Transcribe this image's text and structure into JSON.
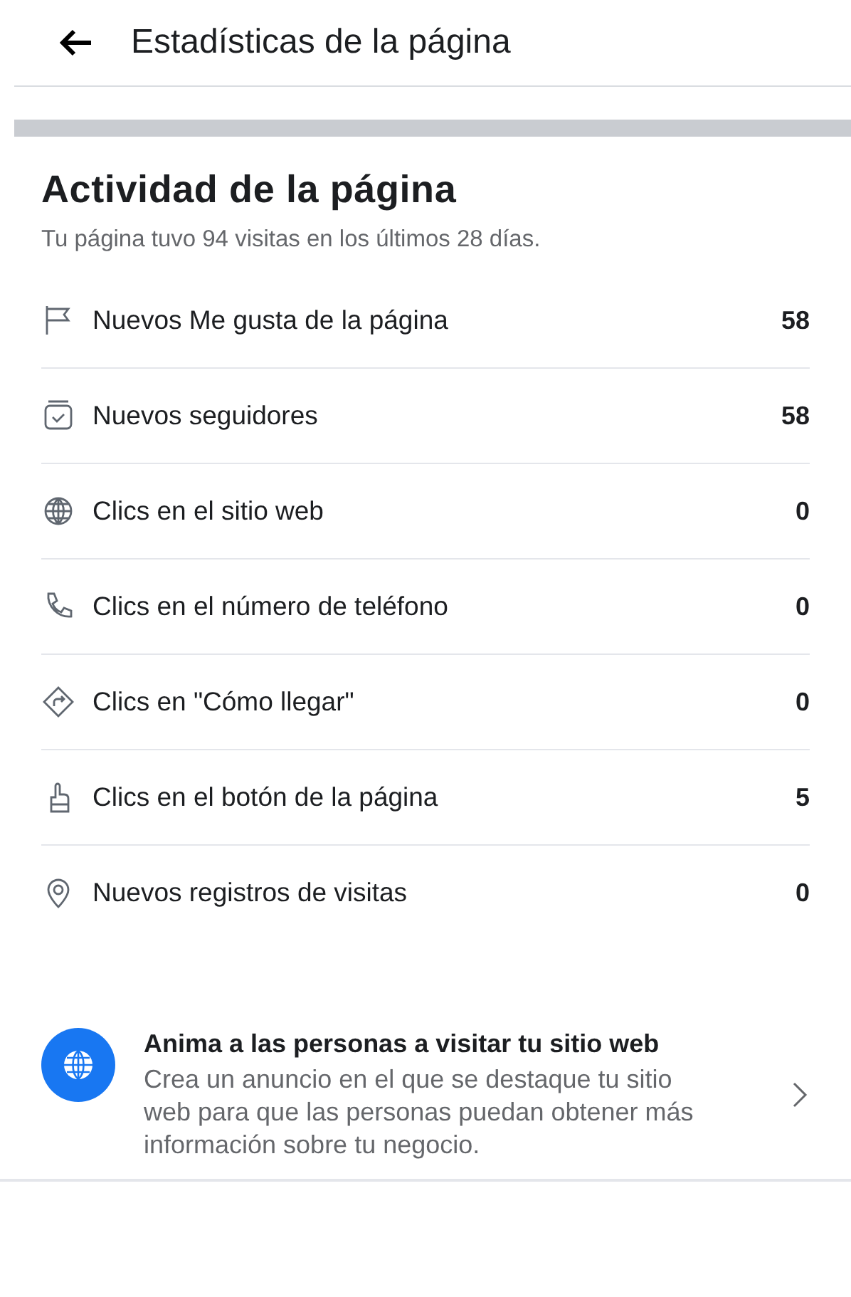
{
  "header": {
    "title": "Estadísticas de la página"
  },
  "section": {
    "title": "Actividad de la página",
    "subtitle": "Tu página tuvo 94 visitas en los últimos 28 días."
  },
  "rows": [
    {
      "kind": "flag",
      "label": "Nuevos Me gusta de la página",
      "value": "58"
    },
    {
      "kind": "calendar",
      "label": "Nuevos seguidores",
      "value": "58"
    },
    {
      "kind": "globe",
      "label": "Clics en el sitio web",
      "value": "0"
    },
    {
      "kind": "phone",
      "label": "Clics en el número de teléfono",
      "value": "0"
    },
    {
      "kind": "directions",
      "label": "Clics en \"Cómo llegar\"",
      "value": "0"
    },
    {
      "kind": "hand",
      "label": "Clics en el botón de la página",
      "value": "5"
    },
    {
      "kind": "pin",
      "label": "Nuevos registros de visitas",
      "value": "0"
    }
  ],
  "promo": {
    "title": "Anima a las personas a visitar tu sitio web",
    "description": "Crea un anuncio en el que se destaque tu sitio web para que las personas puedan obtener más información sobre tu negocio."
  }
}
